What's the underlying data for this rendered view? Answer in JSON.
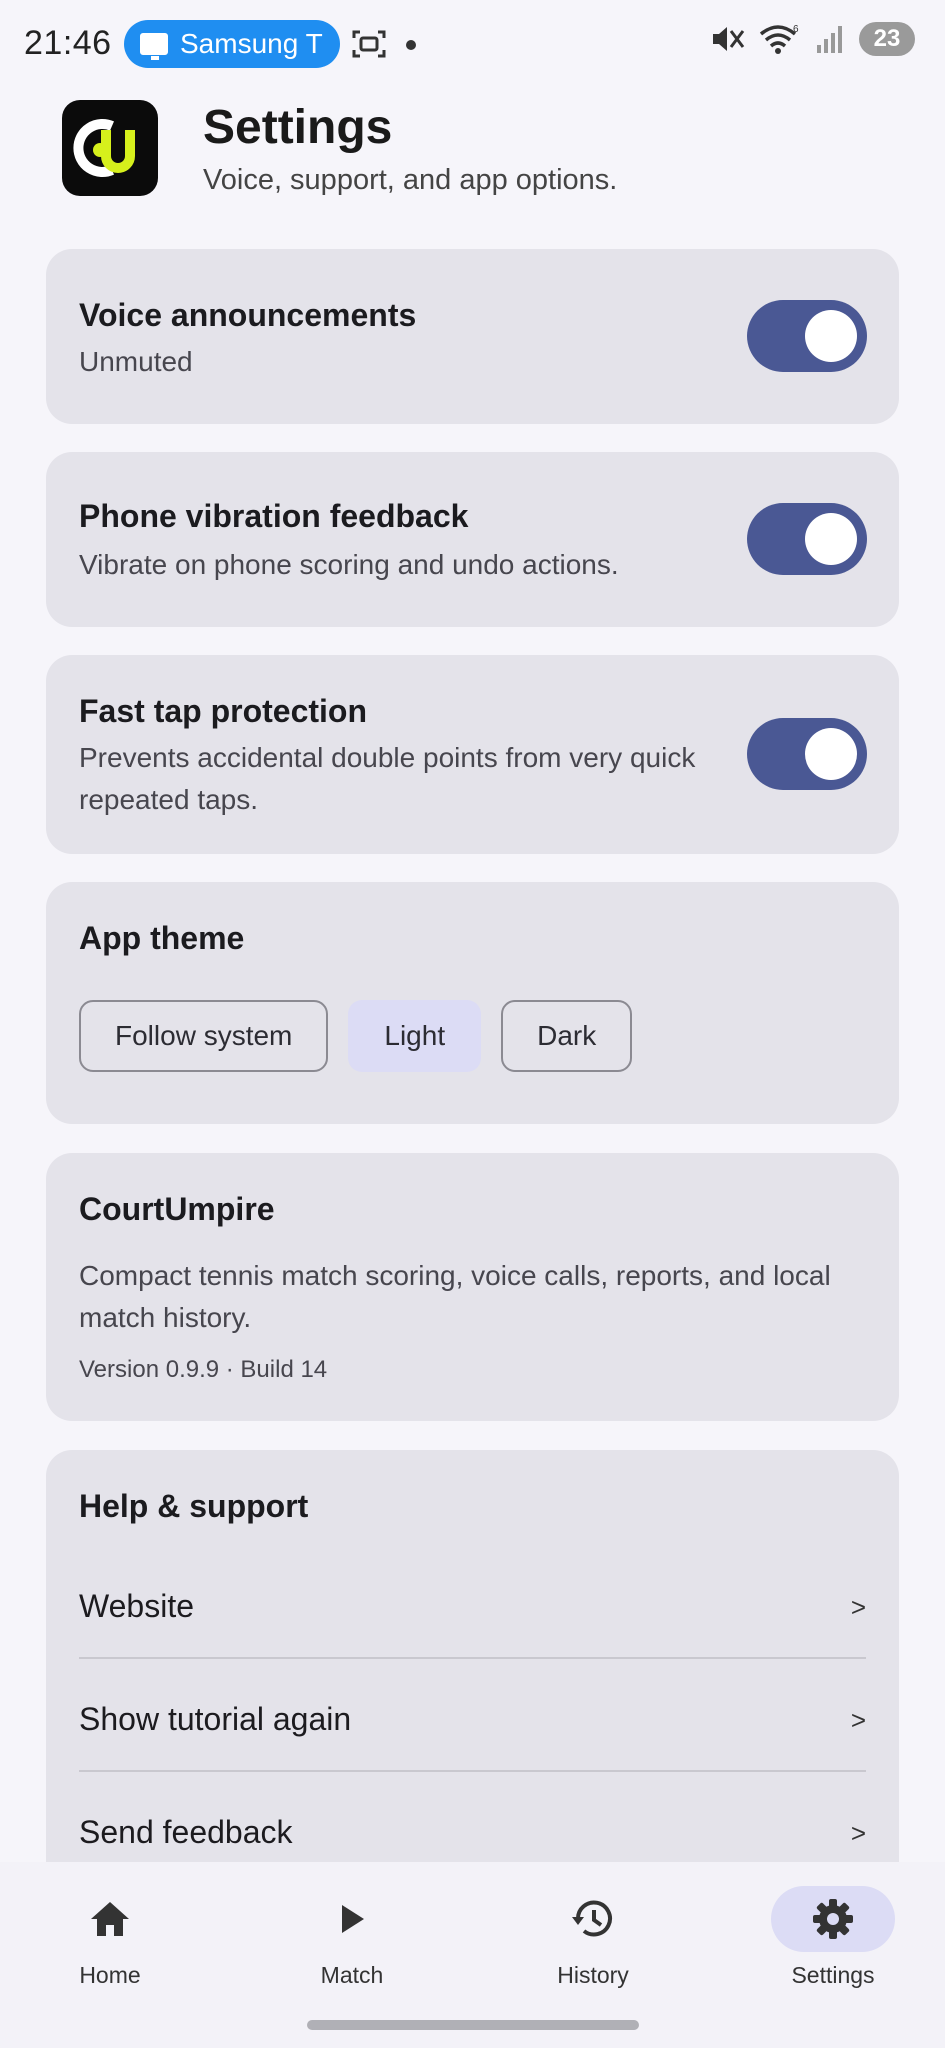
{
  "status_bar": {
    "time": "21:46",
    "cast_label": "Samsung T",
    "battery": "23"
  },
  "header": {
    "title": "Settings",
    "subtitle": "Voice, support, and app options."
  },
  "settings": {
    "voice": {
      "title": "Voice announcements",
      "desc": "Unmuted",
      "enabled": true
    },
    "vibration": {
      "title": "Phone vibration feedback",
      "desc": "Vibrate on phone scoring and undo actions.",
      "enabled": true
    },
    "fasttap": {
      "title": "Fast tap protection",
      "desc": "Prevents accidental double points from very quick repeated taps.",
      "enabled": true
    }
  },
  "theme": {
    "title": "App theme",
    "options": [
      "Follow system",
      "Light",
      "Dark"
    ],
    "selected": "Light"
  },
  "about": {
    "title": "CourtUmpire",
    "desc": "Compact tennis match scoring, voice calls, reports, and local match history.",
    "version": "Version 0.9.9 · Build 14"
  },
  "help": {
    "title": "Help & support",
    "items": [
      {
        "label": "Website",
        "chevron": ">"
      },
      {
        "label": "Show tutorial again",
        "chevron": ">"
      },
      {
        "label": "Send feedback",
        "chevron": ">"
      }
    ]
  },
  "nav": {
    "items": [
      {
        "label": "Home",
        "icon": "home-icon"
      },
      {
        "label": "Match",
        "icon": "play-icon"
      },
      {
        "label": "History",
        "icon": "history-icon"
      },
      {
        "label": "Settings",
        "icon": "gear-icon"
      }
    ],
    "active": "Settings"
  },
  "colors": {
    "accent": "#4a5894",
    "card": "#e4e3ea",
    "selected_chip": "#dcdcf5",
    "logo_yellow": "#d6f01c"
  }
}
